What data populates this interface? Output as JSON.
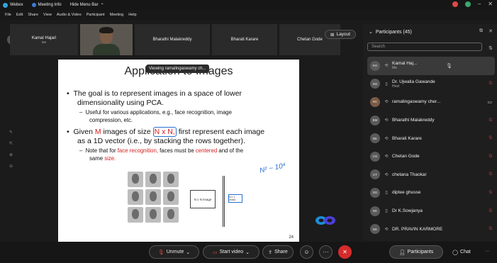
{
  "titlebar": {
    "app": "Webex",
    "meeting_info": "Meeting Info",
    "hide_menu": "Hide Menu Bar",
    "minimize": "–",
    "close": "✕"
  },
  "menu": [
    "File",
    "Edit",
    "Share",
    "View",
    "Audio & Video",
    "Participant",
    "Meeting",
    "Help"
  ],
  "video_strip": {
    "tiles": [
      {
        "name": "Kamal Hajari",
        "sub": "Me"
      },
      {
        "name": "",
        "sub": ""
      },
      {
        "name": "Bharathi Malakreddy",
        "sub": ""
      },
      {
        "name": "Bharati Karare",
        "sub": ""
      },
      {
        "name": "Chetan Gode",
        "sub": ""
      }
    ],
    "layout_label": "Layout"
  },
  "slide": {
    "title": "Application to Images",
    "viewing": "Viewing ramalingaswamy ch...",
    "b1": "The goal is to represent images in a space of lower",
    "b1b": "dimensionality using PCA.",
    "s1": "Useful for various applications, e.g., face recognition, image",
    "s1b": "compression, etc.",
    "b2_pre": "Given",
    "b2_m": "M",
    "b2_mid": "images of size",
    "b2_nxn": "N x N,",
    "b2_post": "first represent each image",
    "b2b": "as a 1D vector (i.e., by stacking the rows together).",
    "s2_pre": "Note that for",
    "s2_face": "face recognition,",
    "s2_mid": "faces must be",
    "s2_centered": "centered",
    "s2_post": "and of the",
    "s2b_pre": "same",
    "s2b_size": "size.",
    "nbox": "N x N image",
    "vecbox": "N x 1 vector",
    "annot": "N² ~ 10⁴",
    "page": "24"
  },
  "panel": {
    "title": "Participants (45)",
    "search_placeholder": "Search",
    "participants": [
      {
        "initials": "KH",
        "name": "Kamal Haj...",
        "role": "Me",
        "mic": "muted-white",
        "device": "phone"
      },
      {
        "initials": "DG",
        "name": "Dr. Ujwalla Gawande",
        "role": "Host",
        "mic": "muted",
        "device": "laptop"
      },
      {
        "initials": "RC",
        "name": "ramalingaswamy cher...",
        "role": "",
        "mic": "camera",
        "device": "phone"
      },
      {
        "initials": "BM",
        "name": "Bharathi Malakreddy",
        "role": "",
        "mic": "muted",
        "device": "phone"
      },
      {
        "initials": "BK",
        "name": "Bharati Karare",
        "role": "",
        "mic": "muted",
        "device": "phone"
      },
      {
        "initials": "CG",
        "name": "Chetan Gode",
        "role": "",
        "mic": "muted",
        "device": "phone"
      },
      {
        "initials": "CT",
        "name": "chetana Thaokar",
        "role": "",
        "mic": "muted",
        "device": "phone"
      },
      {
        "initials": "DG",
        "name": "diptee ghusse",
        "role": "",
        "mic": "muted",
        "device": "laptop"
      },
      {
        "initials": "DK",
        "name": "Dr K.Sowjanya",
        "role": "",
        "mic": "muted",
        "device": "laptop"
      },
      {
        "initials": "DK",
        "name": "DR. PRAVIN KARMORE",
        "role": "",
        "mic": "muted",
        "device": "phone"
      }
    ]
  },
  "controls": {
    "unmute": "Unmute",
    "start_video": "Start video",
    "share": "Share",
    "participants": "Participants",
    "chat": "Chat",
    "leave": "✕",
    "more": "···"
  },
  "colors": {
    "leave": "#d52b2b",
    "muted": "#e04848",
    "accent": "#2a6fd1"
  }
}
